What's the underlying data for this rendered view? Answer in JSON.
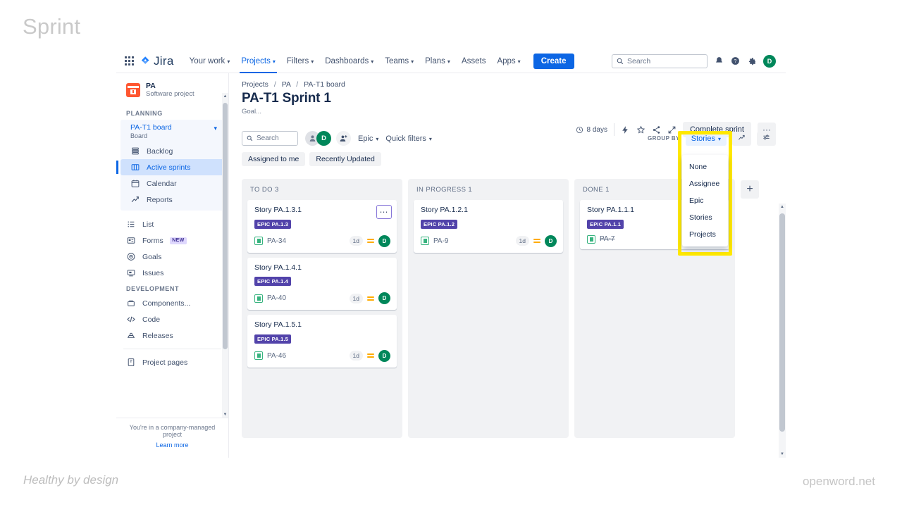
{
  "slide": {
    "title": "Sprint",
    "footer_left": "Healthy by design",
    "footer_right": "openword.net"
  },
  "topnav": {
    "app_name": "Jira",
    "items": [
      {
        "label": "Your work",
        "caret": "⌄",
        "active": false
      },
      {
        "label": "Projects",
        "caret": "⌄",
        "active": true
      },
      {
        "label": "Filters",
        "caret": "⌄",
        "active": false
      },
      {
        "label": "Dashboards",
        "caret": "⌄",
        "active": false
      },
      {
        "label": "Teams",
        "caret": "⌄",
        "active": false
      },
      {
        "label": "Plans",
        "caret": "⌄",
        "active": false
      },
      {
        "label": "Assets",
        "caret": "",
        "active": false
      },
      {
        "label": "Apps",
        "caret": "⌄",
        "active": false
      }
    ],
    "create_label": "Create",
    "search_placeholder": "Search",
    "avatar_initial": "D"
  },
  "sidebar": {
    "project_name": "PA",
    "project_type": "Software project",
    "planning_label": "PLANNING",
    "board_name": "PA-T1 board",
    "board_sub": "Board",
    "planning_items": [
      {
        "label": "Backlog",
        "icon": "backlog-icon",
        "selected": false
      },
      {
        "label": "Active sprints",
        "icon": "board-icon",
        "selected": true
      },
      {
        "label": "Calendar",
        "icon": "calendar-icon",
        "selected": false
      },
      {
        "label": "Reports",
        "icon": "reports-icon",
        "selected": false
      }
    ],
    "other_items": [
      {
        "label": "List",
        "icon": "list-icon",
        "badge": ""
      },
      {
        "label": "Forms",
        "icon": "forms-icon",
        "badge": "NEW"
      },
      {
        "label": "Goals",
        "icon": "goals-icon",
        "badge": ""
      },
      {
        "label": "Issues",
        "icon": "issues-icon",
        "badge": ""
      }
    ],
    "development_label": "DEVELOPMENT",
    "development_items": [
      {
        "label": "Components...",
        "icon": "components-icon"
      },
      {
        "label": "Code",
        "icon": "code-icon"
      },
      {
        "label": "Releases",
        "icon": "releases-icon"
      }
    ],
    "pages_items": [
      {
        "label": "Project pages",
        "icon": "pages-icon"
      }
    ],
    "footer_note": "You're in a company-managed project",
    "footer_link": "Learn more"
  },
  "main": {
    "breadcrumb": [
      "Projects",
      "PA",
      "PA-T1 board"
    ],
    "page_title": "PA-T1 Sprint 1",
    "goal": "Goal...",
    "days_remaining": "8 days",
    "complete_sprint_label": "Complete sprint",
    "more_label": "···"
  },
  "toolbar": {
    "search_placeholder": "Search",
    "avatar_initial": "D",
    "epic_label": "Epic",
    "quick_filters_label": "Quick filters",
    "group_by_label": "GROUP BY",
    "group_by_value": "Stories",
    "chips": [
      "Assigned to me",
      "Recently Updated"
    ]
  },
  "group_by_menu": {
    "options": [
      "None",
      "Assignee",
      "Epic",
      "Stories",
      "Projects"
    ]
  },
  "board": {
    "add_column_label": "+",
    "columns": [
      {
        "name": "TO DO",
        "count": "3",
        "header": "TO DO 3",
        "cards": [
          {
            "title": "Story PA.1.3.1",
            "epic": "EPIC PA.1.3",
            "key": "PA-34",
            "estimate": "1d",
            "assignee": "D",
            "done": false,
            "menu_open": true
          },
          {
            "title": "Story PA.1.4.1",
            "epic": "EPIC PA.1.4",
            "key": "PA-40",
            "estimate": "1d",
            "assignee": "D",
            "done": false,
            "menu_open": false
          },
          {
            "title": "Story PA.1.5.1",
            "epic": "EPIC PA.1.5",
            "key": "PA-46",
            "estimate": "1d",
            "assignee": "D",
            "done": false,
            "menu_open": false
          }
        ]
      },
      {
        "name": "IN PROGRESS",
        "count": "1",
        "header": "IN PROGRESS 1",
        "cards": [
          {
            "title": "Story PA.1.2.1",
            "epic": "EPIC PA.1.2",
            "key": "PA-9",
            "estimate": "1d",
            "assignee": "D",
            "done": false,
            "menu_open": false
          }
        ]
      },
      {
        "name": "DONE",
        "count": "1",
        "header": "DONE 1",
        "cards": [
          {
            "title": "Story PA.1.1.1",
            "epic": "EPIC PA.1.1",
            "key": "PA-7",
            "estimate": "",
            "assignee": "",
            "done": true,
            "menu_open": false
          }
        ]
      }
    ]
  },
  "colors": {
    "brand_blue": "#0c66e4",
    "highlight_yellow": "#ffe800",
    "epic_purple": "#5243aa",
    "avatar_green": "#00875a",
    "priority_amber": "#ffab00",
    "project_orange": "#ff5630"
  }
}
